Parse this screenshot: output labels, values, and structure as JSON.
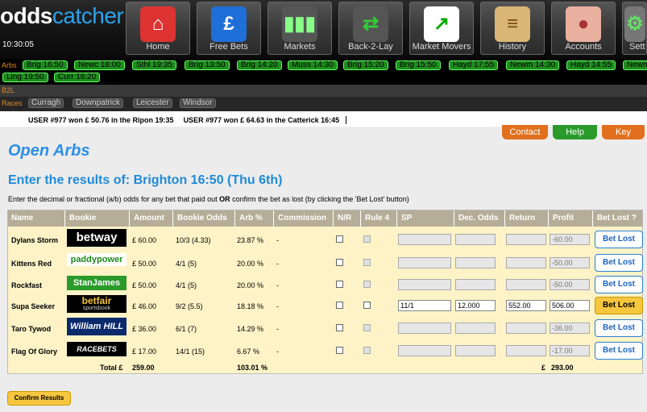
{
  "logo": {
    "part1": "odds",
    "part2": "catcher"
  },
  "clock": "10:30:05",
  "nav": [
    {
      "label": "Home",
      "icon": "home-icon"
    },
    {
      "label": "Free Bets",
      "icon": "pound-icon"
    },
    {
      "label": "Markets",
      "icon": "bar-chart-icon"
    },
    {
      "label": "Back-2-Lay",
      "icon": "arrows-icon"
    },
    {
      "label": "Market Movers",
      "icon": "trend-chart-icon"
    },
    {
      "label": "History",
      "icon": "scroll-icon"
    },
    {
      "label": "Accounts",
      "icon": "piggy-bank-icon"
    },
    {
      "label": "Sett",
      "icon": "settings-icon"
    }
  ],
  "arbs_label": "Arbs",
  "arbs": [
    "Brig 16:50",
    "Newc 18:00",
    "Sthl 19:35",
    "Brig 13:50",
    "Brig 14:20",
    "Muss 14:30",
    "Brig 15:20",
    "Brig 15:50",
    "Hayd 17:55",
    "Newm 14:30",
    "Hayd 14:55",
    "Newm",
    "Ling 19:50",
    "Curr 16:20"
  ],
  "b2l_label": "B2L",
  "races_label": "Races",
  "races": [
    "Curragh",
    "Downpatrick",
    "Leicester",
    "Windsor"
  ],
  "ticker": [
    "USER #977 won £ 50.76 in the Ripon 19:35",
    "USER #977 won £ 64.63 in the Catterick 16:45"
  ],
  "tabs": {
    "contact": "Contact",
    "help": "Help",
    "key": "Key"
  },
  "page_title": "Open Arbs",
  "subtitle": "Enter the results of: Brighton 16:50 (Thu 6th)",
  "instructions": {
    "before": "Enter the decimal or fractional (a/b) odds for any bet that paid out ",
    "bold": "OR",
    "after": " confirm the bet as lost (by clicking the 'Bet Lost' button)"
  },
  "columns": [
    "Name",
    "Bookie",
    "Amount",
    "Bookie Odds",
    "Arb %",
    "Commission",
    "N/R",
    "Rule 4",
    "SP",
    "Dec. Odds",
    "Return",
    "Profit",
    "Bet Lost ?"
  ],
  "rows": [
    {
      "name": "Dylans Storm",
      "bookie": "betway",
      "amount": "£ 60.00",
      "odds": "10/3 (4.33)",
      "arb": "23.87 %",
      "commission": "-",
      "sp": "",
      "dec": "",
      "ret": "",
      "profit": "-60.00",
      "btn": "Bet Lost"
    },
    {
      "name": "Kittens Red",
      "bookie": "paddypower",
      "amount": "£ 50.00",
      "odds": "4/1 (5)",
      "arb": "20.00 %",
      "commission": "-",
      "sp": "",
      "dec": "",
      "ret": "",
      "profit": "-50.00",
      "btn": "Bet Lost"
    },
    {
      "name": "Rockfast",
      "bookie": "StanJames",
      "amount": "£ 50.00",
      "odds": "4/1 (5)",
      "arb": "20.00 %",
      "commission": "-",
      "sp": "",
      "dec": "",
      "ret": "",
      "profit": "-50.00",
      "btn": "Bet Lost"
    },
    {
      "name": "Supa Seeker",
      "bookie": "betfair",
      "bookie_sub": "sportsbook",
      "amount": "£ 46.00",
      "odds": "9/2 (5.5)",
      "arb": "18.18 %",
      "commission": "-",
      "sp": "11/1",
      "dec": "12.000",
      "ret": "552.00",
      "profit": "506.00",
      "btn": "Bet Lost"
    },
    {
      "name": "Taro Tywod",
      "bookie": "William HILL",
      "amount": "£ 36.00",
      "odds": "6/1 (7)",
      "arb": "14.29 %",
      "commission": "-",
      "sp": "",
      "dec": "",
      "ret": "",
      "profit": "-36.00",
      "btn": "Bet Lost"
    },
    {
      "name": "Flag Of Glory",
      "bookie": "RACEBETS",
      "amount": "£ 17.00",
      "odds": "14/1 (15)",
      "arb": "6.67 %",
      "commission": "-",
      "sp": "",
      "dec": "",
      "ret": "",
      "profit": "-17.00",
      "btn": "Bet Lost"
    }
  ],
  "totals": {
    "label": "Total £",
    "amount": "259.00",
    "arb": "103.01 %",
    "currency": "£",
    "profit": "293.00"
  },
  "confirm_label": "Confirm Results",
  "colors": {
    "accent": "#2c8fe6",
    "header_bg": "#b5ad97",
    "table_bg": "#fdf3c7",
    "green": "#1e8c1e",
    "orange": "#e0701e",
    "gold": "#f6c63e"
  }
}
